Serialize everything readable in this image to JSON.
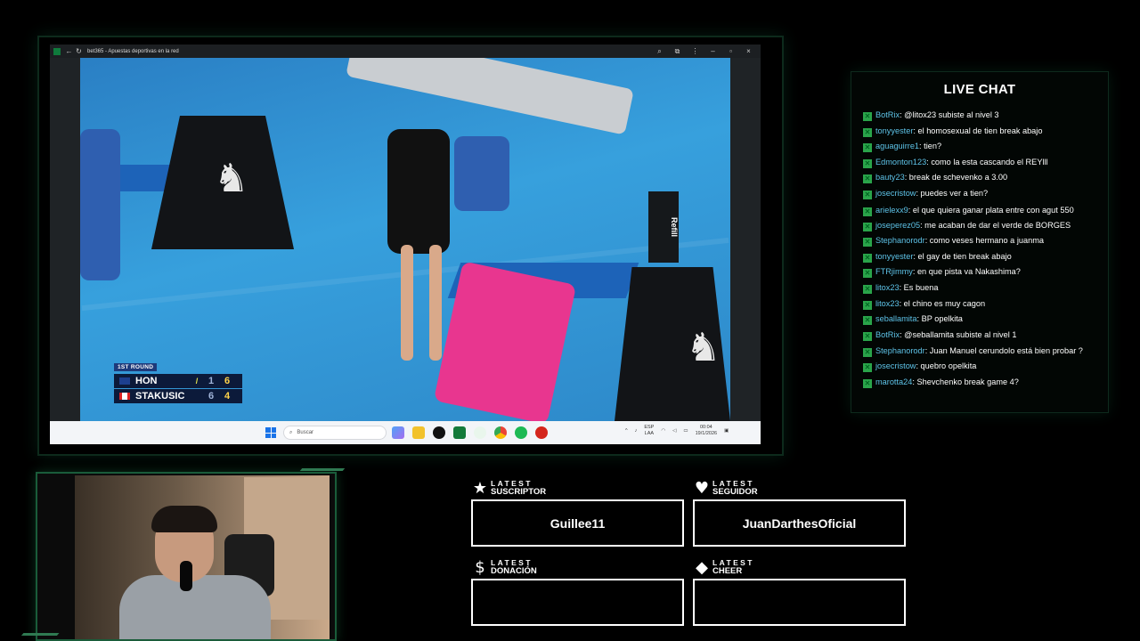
{
  "browser": {
    "tab_title": "bet365 - Apuestas deportivas en la red"
  },
  "video": {
    "scoreboard": {
      "round": "1ST ROUND",
      "players": [
        {
          "name": "HON",
          "serve": "/",
          "set1": "1",
          "set2": "6",
          "flag": "Australia"
        },
        {
          "name": "STAKUSIC",
          "serve": "",
          "set1": "6",
          "set2": "4",
          "flag": "Canada"
        }
      ]
    },
    "refill_text": "Refill"
  },
  "taskbar": {
    "search_placeholder": "Buscar",
    "lang_top": "ESP",
    "lang_bottom": "LAA",
    "time": "00:04",
    "date": "19/1/2026"
  },
  "chat": {
    "title": "LIVE CHAT",
    "messages": [
      {
        "user": "BotRix",
        "text": ": @litox23 subiste al nivel 3"
      },
      {
        "user": "tonyyester",
        "text": ": el homosexual de tien break abajo"
      },
      {
        "user": "aguaguirre1",
        "text": ": tien?"
      },
      {
        "user": "Edmonton123",
        "text": ": como la esta cascando el REYlll"
      },
      {
        "user": "bauty23",
        "text": ": break de schevenko a 3.00"
      },
      {
        "user": "josecristow",
        "text": ": puedes ver a tien?"
      },
      {
        "user": "arielexx9",
        "text": ": el que quiera ganar plata entre con agut 550"
      },
      {
        "user": "joseperez05",
        "text": ": me acaban de dar el verde de BORGES"
      },
      {
        "user": "Stephanorodr",
        "text": ": como veses hermano a juanma"
      },
      {
        "user": "tonyyester",
        "text": ": el gay de tien break abajo"
      },
      {
        "user": "FTRjimmy",
        "text": ": en que pista va Nakashima?"
      },
      {
        "user": "litox23",
        "text": ": Es buena"
      },
      {
        "user": "litox23",
        "text": ": el chino es muy cagon"
      },
      {
        "user": "seballamita",
        "text": ": BP opelkita"
      },
      {
        "user": "BotRix",
        "text": ": @seballamita subiste al nivel 1"
      },
      {
        "user": "Stephanorodr",
        "text": ": Juan Manuel cerundolo está bien probar ?"
      },
      {
        "user": "josecristow",
        "text": ": quebro opelkita"
      },
      {
        "user": "marotta24",
        "text": ": Shevchenko break game 4?"
      }
    ]
  },
  "widgets": {
    "suscriptor": {
      "line1": "LATEST",
      "line2": "SUSCRIPTOR",
      "value": "Guillee11",
      "icon": "star-icon"
    },
    "seguidor": {
      "line1": "LATEST",
      "line2": "SEGUIDOR",
      "value": "JuanDarthesOficial",
      "icon": "heart-icon"
    },
    "donacion": {
      "line1": "LATEST",
      "line2": "DONACIÓN",
      "value": "",
      "icon": "dollar-icon"
    },
    "cheer": {
      "line1": "LATEST",
      "line2": "CHEER",
      "value": "",
      "icon": "diamond-icon"
    }
  },
  "colors": {
    "accent_green": "#2aa44a",
    "chat_username": "#5ec3e8",
    "frame_glow": "#1a5c3a"
  }
}
